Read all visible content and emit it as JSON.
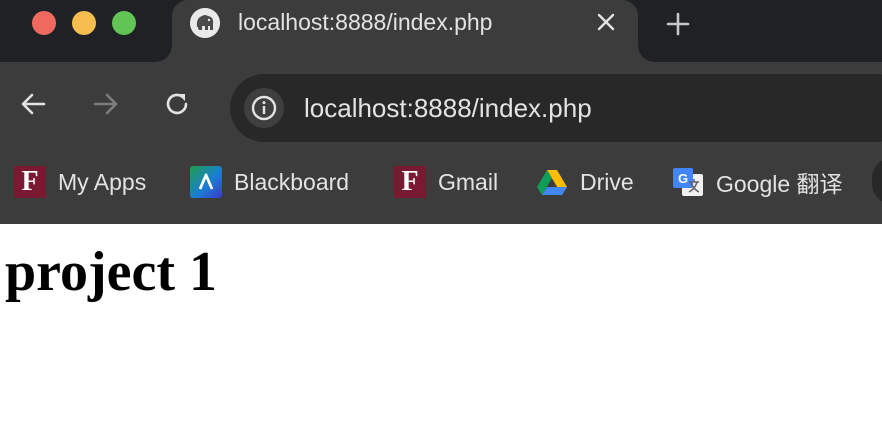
{
  "window": {
    "traffic_lights": [
      {
        "name": "close",
        "color": "#ee6a5f"
      },
      {
        "name": "minimize",
        "color": "#f5be4f"
      },
      {
        "name": "zoom",
        "color": "#61c454"
      }
    ]
  },
  "tabs": [
    {
      "title": "localhost:8888/index.php",
      "favicon": "mamp-elephant-icon",
      "close_icon": "close-icon"
    }
  ],
  "new_tab_icon": "plus-icon",
  "toolbar": {
    "back_icon": "arrow-left-icon",
    "forward_icon": "arrow-right-icon",
    "reload_icon": "reload-icon",
    "site_info_icon": "info-icon",
    "url": "localhost:8888/index.php"
  },
  "bookmarks": [
    {
      "label": "My Apps",
      "icon": "f-logo-icon",
      "icon_color": "#7a1a32"
    },
    {
      "label": "Blackboard",
      "icon": "blackboard-icon"
    },
    {
      "label": "Gmail",
      "icon": "f-logo-icon",
      "icon_color": "#7a1a32"
    },
    {
      "label": "Drive",
      "icon": "google-drive-icon"
    },
    {
      "label": "Google 翻译",
      "icon": "google-translate-icon"
    }
  ],
  "bookmark_icon_text": {
    "f_logo": "F"
  },
  "page": {
    "heading": "project 1"
  },
  "colors": {
    "tabstrip": "#202124",
    "toolbar": "#3c3c3c",
    "omnibox": "#282828",
    "text": "#e3e3e3"
  }
}
